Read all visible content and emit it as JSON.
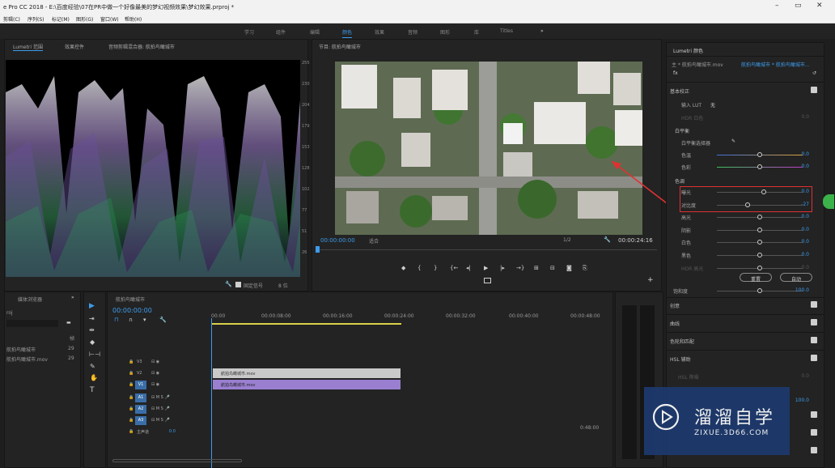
{
  "title_bar": {
    "title": "e Pro CC 2018 - E:\\百度经验\\07在PR中做一个好像最美的梦幻视频效果\\梦幻效果.prproj *",
    "minimize": "–",
    "maximize": "▭",
    "close": "✕"
  },
  "menu": [
    "剪辑(C)",
    "序列(S)",
    "标记(M)",
    "图形(G)",
    "窗口(W)",
    "帮助(H)"
  ],
  "workspaces": {
    "tabs": [
      "学习",
      "组件",
      "编辑",
      "颜色",
      "效果",
      "音频",
      "图形",
      "库",
      "Titles"
    ],
    "active": "颜色",
    "overflow": "»"
  },
  "scope_panel": {
    "tabs": [
      "Lumetri 范围",
      "效果控件",
      "音频剪辑混合器: 航拍鸟瞰城市"
    ],
    "active": "Lumetri 范围",
    "tick_labels": [
      "255",
      "230",
      "204",
      "179",
      "153",
      "128",
      "102",
      "77",
      "51",
      "26"
    ],
    "clamp_label": "固定信号",
    "bit_depth": "8 位"
  },
  "program_monitor": {
    "title": "节目: 航拍鸟瞰城市",
    "timecode": "00:00:00:00",
    "fit": "适合",
    "resolution": "1/2",
    "duration": "00:00:24:16",
    "controls": [
      "◆",
      "{",
      "}",
      "{←",
      "◂|",
      "▶",
      "|▸",
      "→}",
      "⊞",
      "⊟",
      "◙",
      "⎘"
    ]
  },
  "project_panel": {
    "title": "媒体浏览器",
    "overflow": "»",
    "label": "roj",
    "items": [
      {
        "name": "航拍鸟瞰城市",
        "fps": "29"
      },
      {
        "name": "航拍鸟瞰城市.mov",
        "fps": "29"
      }
    ],
    "fps_header": "帧"
  },
  "timeline": {
    "sequence": "航拍鸟瞰城市",
    "timecode": "00:00:00:00",
    "ruler": [
      "00:00",
      "00:00:08:00",
      "00:00:16:00",
      "00:00:24:00",
      "00:00:32:00",
      "00:00:40:00",
      "00:00:48:00"
    ],
    "video_tracks": [
      "V3",
      "V2",
      "V1"
    ],
    "audio_tracks": [
      "A1",
      "A2",
      "A3"
    ],
    "master": "主声道",
    "master_value": "0.0",
    "clips": [
      {
        "name": "航拍鸟瞰城市.mov",
        "track": "V2",
        "color": "#c9c9c9"
      },
      {
        "name": "航拍鸟瞰城市.mov",
        "track": "V1",
        "color": "#9a7fd1"
      }
    ],
    "end_time": "0:48:00"
  },
  "lumetri": {
    "title": "Lumetri 颜色",
    "clip_path": "主 * 航拍鸟瞰城市.mov",
    "clip_link": "航拍鸟瞰城市 * 航拍鸟瞰城市...",
    "fx_label": "fx",
    "basic_correction": "基本校正",
    "input_lut_label": "输入 LUT",
    "input_lut_value": "无",
    "hdr_white_label": "HDR 白色",
    "hdr_white_value": "0.0",
    "white_balance": "白平衡",
    "wb_selector": "白平衡选择器",
    "temperature": {
      "label": "色温",
      "value": "0.0"
    },
    "tint": {
      "label": "色彩",
      "value": "0.0"
    },
    "tone": "色调",
    "sliders": [
      {
        "label": "曝光",
        "value": "0.0",
        "pos": 0.55
      },
      {
        "label": "对比度",
        "value": "-27",
        "pos": 0.36
      },
      {
        "label": "高光",
        "value": "0.0",
        "pos": 0.5
      },
      {
        "label": "阴影",
        "value": "0.0",
        "pos": 0.5
      },
      {
        "label": "白色",
        "value": "0.0",
        "pos": 0.5
      },
      {
        "label": "黑色",
        "value": "0.0",
        "pos": 0.5
      },
      {
        "label": "HDR 高光",
        "value": "0.0",
        "pos": 0.5
      }
    ],
    "reset_button": "重置",
    "auto_button": "自动",
    "saturation": {
      "label": "饱和度",
      "value": "100.0"
    },
    "sections": [
      "创意",
      "曲线",
      "色轮和匹配",
      "HSL 辅助"
    ],
    "hsl_denoise_label": "HSL 降噪",
    "hsl_denoise_value": "0.0",
    "hsl_value": "100.0"
  },
  "watermark": {
    "brand": "溜溜自学",
    "url": "ZIXUE.3D66.COM"
  },
  "colors": {
    "accent": "#3d9bea",
    "highlight": "#e03131",
    "panel": "#232323"
  }
}
